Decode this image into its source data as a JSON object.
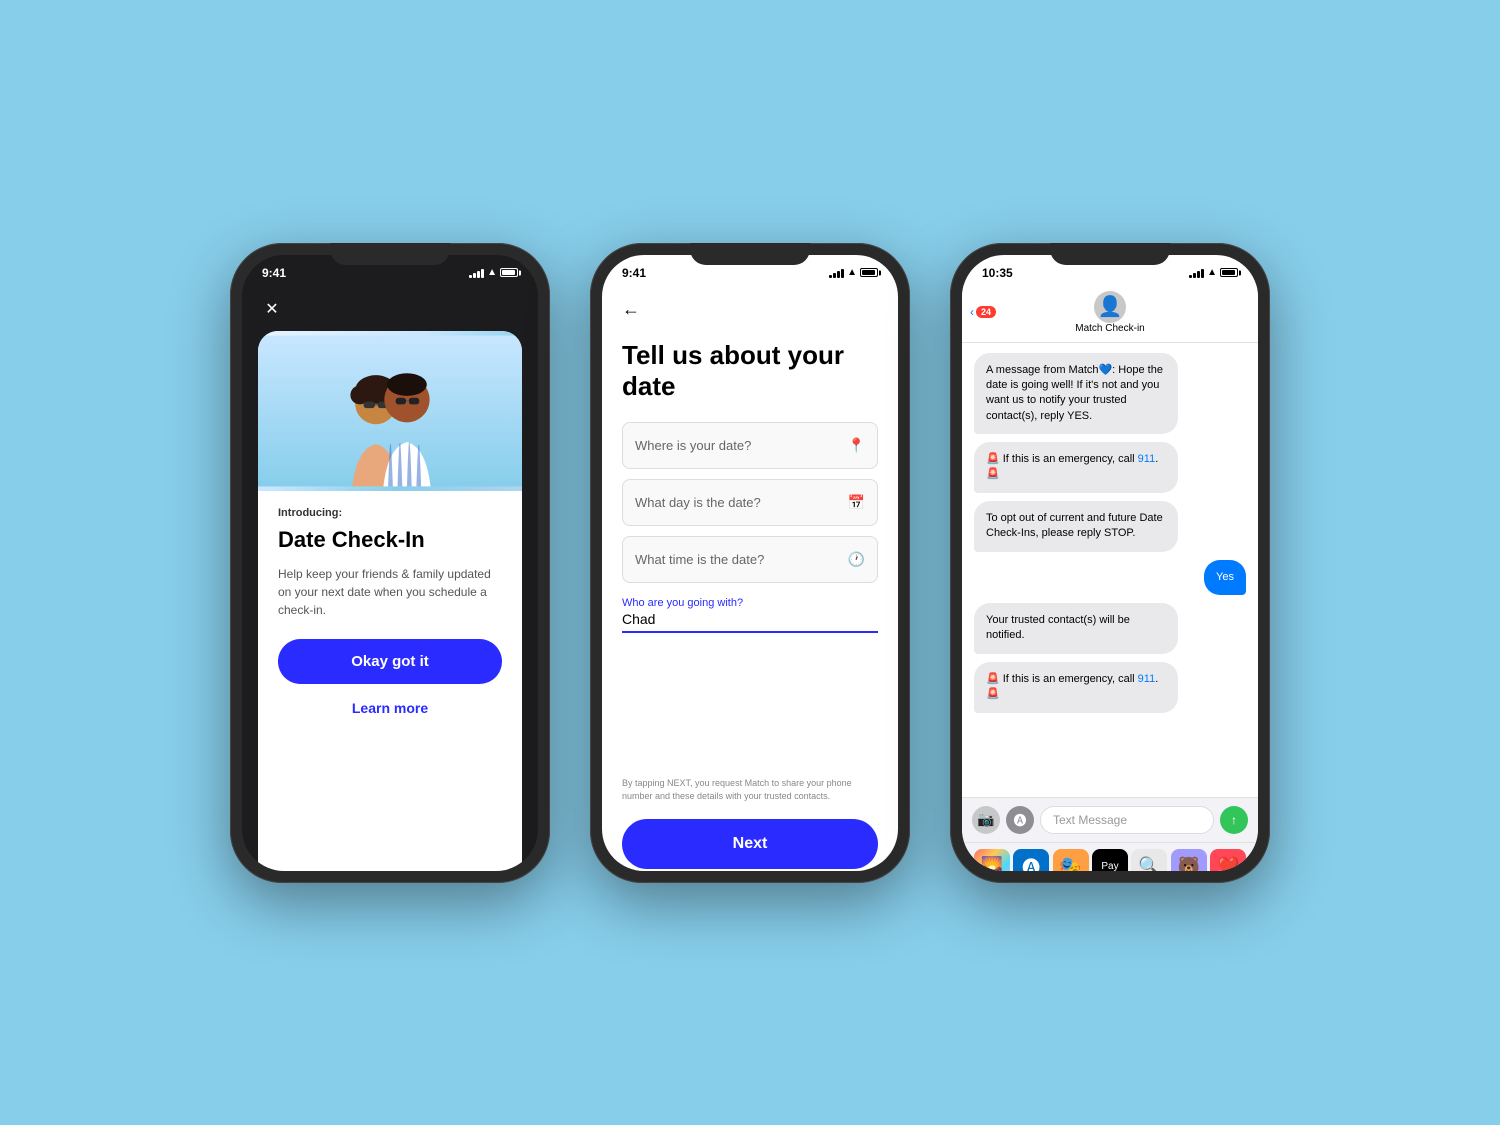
{
  "background": "#87CEEB",
  "phones": [
    {
      "id": "phone1",
      "theme": "dark",
      "status": {
        "time": "9:41",
        "signal": 4,
        "wifi": true,
        "battery": 80
      },
      "content": {
        "close_button": "✕",
        "card": {
          "intro_label": "Introducing:",
          "title": "Date Check-In",
          "description": "Help keep your friends & family updated on your next date when you schedule a check-in.",
          "primary_button": "Okay got it",
          "learn_more_link": "Learn more"
        }
      }
    },
    {
      "id": "phone2",
      "theme": "light",
      "status": {
        "time": "9:41",
        "signal": 4,
        "wifi": true,
        "battery": 80
      },
      "content": {
        "back_arrow": "←",
        "form_title": "Tell us about your date",
        "fields": [
          {
            "placeholder": "Where is your date?",
            "icon": "📍",
            "active": false
          },
          {
            "placeholder": "What day is the date?",
            "icon": "📅",
            "active": false
          },
          {
            "placeholder": "What time is the date?",
            "icon": "🕐",
            "active": false
          }
        ],
        "active_field": {
          "label": "Who are you going with?",
          "value": "Chad"
        },
        "disclaimer": "By tapping NEXT, you request Match to share your phone number and these details with your trusted contacts.",
        "next_button": "Next"
      }
    },
    {
      "id": "phone3",
      "theme": "light",
      "status": {
        "time": "10:35",
        "signal": 4,
        "wifi": true,
        "battery": 80
      },
      "content": {
        "back_label": "24",
        "contact_name": "Match Check-in",
        "messages": [
          {
            "type": "incoming",
            "text": "A message from Match💙: Hope the date is going well! If it's not and you want us to notify your trusted contact(s), reply YES.",
            "has_link": false
          },
          {
            "type": "incoming",
            "text": "🚨 If this is an emergency, call 911. 🚨",
            "has_link": true,
            "link_word": "911"
          },
          {
            "type": "incoming",
            "text": "To opt out of current and future Date Check-Ins, please reply STOP.",
            "has_link": false
          },
          {
            "type": "outgoing",
            "text": "Yes",
            "has_link": false
          },
          {
            "type": "incoming",
            "text": "Your trusted contact(s) will be notified.",
            "has_link": false
          },
          {
            "type": "incoming",
            "text": "🚨 If this is an emergency, call 911. 🚨",
            "has_link": true,
            "link_word": "911"
          }
        ],
        "input_placeholder": "Text Message",
        "drawer_icons": [
          "🌄",
          "🅐",
          "🎭",
          "🍎Pay",
          "🔍",
          "🐻",
          "❤️"
        ]
      }
    }
  ]
}
